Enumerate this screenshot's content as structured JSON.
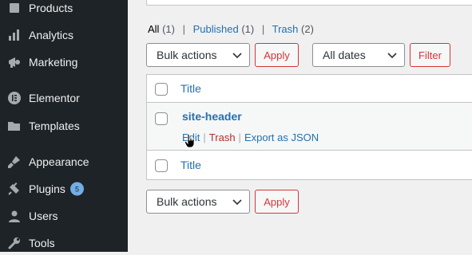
{
  "sidebar": {
    "items": [
      {
        "label": "Products",
        "icon": "products-icon"
      },
      {
        "label": "Analytics",
        "icon": "analytics-icon"
      },
      {
        "label": "Marketing",
        "icon": "marketing-icon"
      },
      {
        "label": "Elementor",
        "icon": "elementor-icon"
      },
      {
        "label": "Templates",
        "icon": "folder-icon"
      },
      {
        "label": "Appearance",
        "icon": "paintbrush-icon"
      },
      {
        "label": "Plugins",
        "icon": "plug-icon",
        "badge": "5"
      },
      {
        "label": "Users",
        "icon": "user-icon"
      },
      {
        "label": "Tools",
        "icon": "wrench-icon"
      }
    ]
  },
  "views": {
    "all_label": "All",
    "all_count": "(1)",
    "published_label": "Published",
    "published_count": "(1)",
    "trash_label": "Trash",
    "trash_count": "(2)",
    "separator": "|"
  },
  "top_controls": {
    "bulk_actions": "Bulk actions",
    "apply": "Apply",
    "dates": "All dates",
    "filter": "Filter"
  },
  "table": {
    "column_title": "Title",
    "footer_title": "Title",
    "rows": [
      {
        "title": "site-header",
        "actions": {
          "edit": "Edit",
          "trash": "Trash",
          "export": "Export as JSON",
          "separator": "|"
        }
      }
    ]
  },
  "bottom_controls": {
    "bulk_actions": "Bulk actions",
    "apply": "Apply"
  },
  "colors": {
    "sidebar_bg": "#1d2327",
    "link": "#2271b1",
    "danger": "#d63638",
    "badge": "#72aee6"
  }
}
